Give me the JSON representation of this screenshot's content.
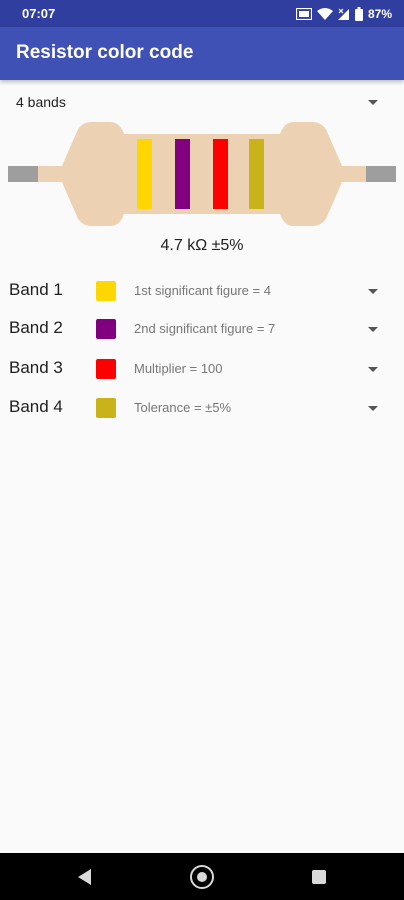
{
  "status_bar": {
    "time": "07:07",
    "battery": "87%",
    "icons": [
      "sim-icon",
      "wifi-icon",
      "signal-icon",
      "battery-icon"
    ]
  },
  "app_bar": {
    "title": "Resistor color code"
  },
  "band_selector": {
    "selected": "4 bands"
  },
  "resistor": {
    "body_color": "#ecd1b3",
    "lead_color": "#9e9e9e",
    "band_colors": [
      "#ffd700",
      "#800080",
      "#ff0000",
      "#c8b41a"
    ]
  },
  "result": {
    "value": "4.7 kΩ ±5%"
  },
  "bands": [
    {
      "label": "Band 1",
      "color": "#ffd700",
      "description": "1st significant figure = 4"
    },
    {
      "label": "Band 2",
      "color": "#800080",
      "description": "2nd significant figure = 7"
    },
    {
      "label": "Band 3",
      "color": "#ff0000",
      "description": "Multiplier = 100"
    },
    {
      "label": "Band 4",
      "color": "#c8b41a",
      "description": "Tolerance = ±5%"
    }
  ],
  "nav_bar": {
    "icons": [
      "back-icon",
      "home-icon",
      "recents-icon"
    ]
  }
}
